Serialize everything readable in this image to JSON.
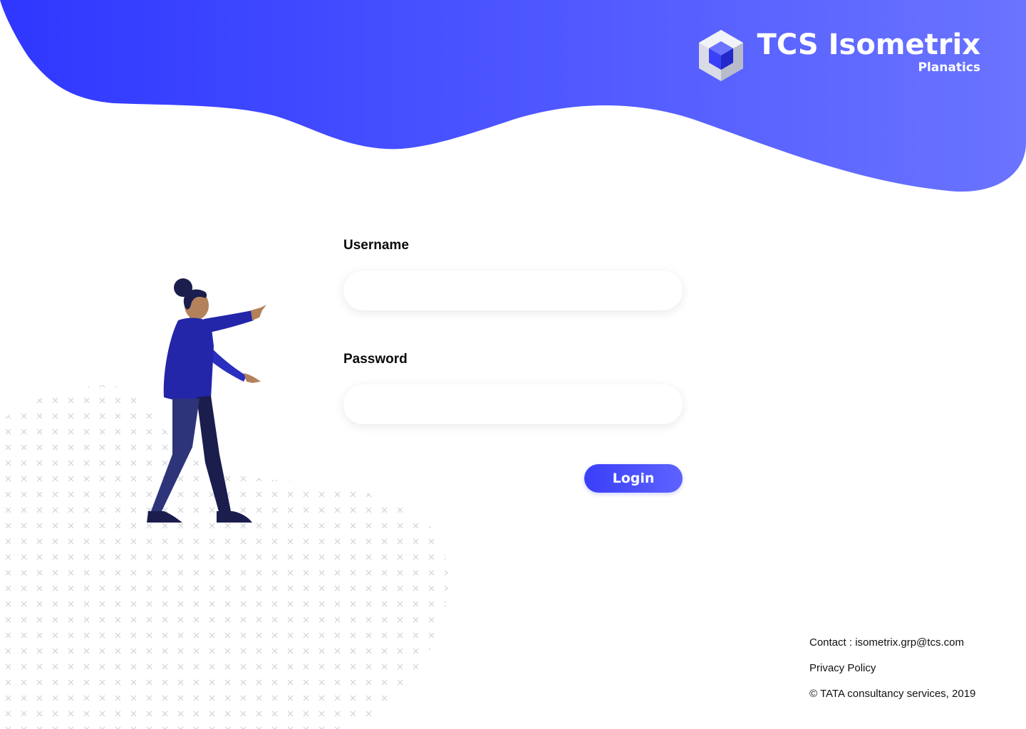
{
  "brand": {
    "name": "TCS Isometrix",
    "subtitle": "Planatics"
  },
  "form": {
    "username_label": "Username",
    "username_value": "",
    "username_placeholder": "",
    "password_label": "Password",
    "password_value": "",
    "password_placeholder": "",
    "login_label": "Login"
  },
  "footer": {
    "contact": "Contact : isometrix.grp@tcs.com",
    "privacy": "Privacy Policy",
    "copyright": "© TATA consultancy services, 2019"
  },
  "colors": {
    "accent_start": "#2f37ff",
    "accent_end": "#6a74ff",
    "text": "#0a0a0a"
  },
  "icons": {
    "logo": "hexagon-cube-logo-icon",
    "illustration": "woman-pointing-illustration",
    "pattern": "x-dot-pattern"
  }
}
